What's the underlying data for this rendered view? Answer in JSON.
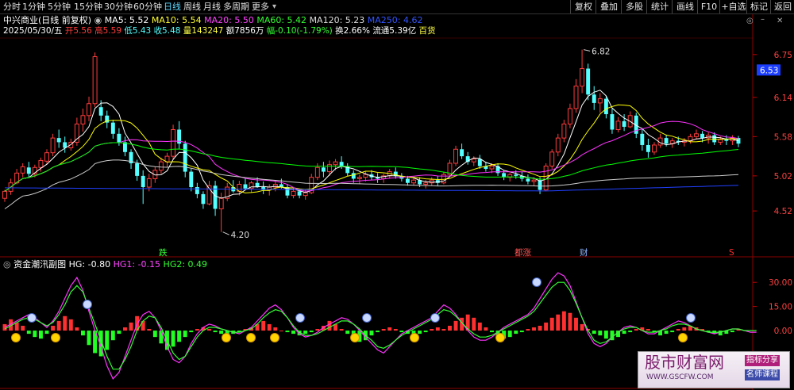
{
  "toolbar": {
    "left_tabs": [
      {
        "label": "分时",
        "x": 4
      },
      {
        "label": "1分钟",
        "x": 28
      },
      {
        "label": "5分钟",
        "x": 60
      },
      {
        "label": "15分钟",
        "x": 93
      },
      {
        "label": "30分钟",
        "x": 131
      },
      {
        "label": "60分钟",
        "x": 168
      },
      {
        "label": "日线",
        "x": 206
      },
      {
        "label": "周线",
        "x": 231
      },
      {
        "label": "月线",
        "x": 256
      },
      {
        "label": "多周期",
        "x": 281
      },
      {
        "label": "更多",
        "x": 317
      }
    ],
    "active_tab": "日线",
    "right_buttons": [
      "复权",
      "叠加",
      "多股",
      "统计",
      "画线",
      "F10",
      "+自选",
      "标记",
      "返回"
    ],
    "icons": [
      "chevron-down-icon",
      "settings-icon",
      "minimize-icon",
      "close-icon"
    ]
  },
  "header": {
    "stock_name": "中兴商业(日线 前复权)",
    "ma5": "MA5: 5.52",
    "ma10": "MA10: 5.54",
    "ma20": "MA20: 5.50",
    "ma60": "MA60: 5.42",
    "ma120": "MA120: 5.23",
    "ma250": "MA250: 4.62",
    "date": "2025/05/30/五",
    "open": "开5.56",
    "high": "高5.59",
    "low": "低5.43",
    "close": "收5.48",
    "volume": "量143247",
    "amount": "额7856万",
    "change": "幅-0.10(-1.79%)",
    "turnover": "换2.66%",
    "float_cap": "流通5.39亿",
    "industry": "百货"
  },
  "price_axis": {
    "ticks": [
      "6.75",
      "6.14",
      "5.58",
      "5.02",
      "4.52"
    ],
    "current": "6.53"
  },
  "price_annotations": {
    "high": "6.82",
    "low": "4.20",
    "markers": [
      "跌",
      "都涨",
      "财",
      "S"
    ]
  },
  "indicator": {
    "title": "资金潮汛副图",
    "hg": "HG: -0.80",
    "hg1": "HG1: -0.15",
    "hg2": "HG2: 0.49",
    "ticks": [
      "30.00",
      "15.00",
      "0.00"
    ]
  },
  "watermark": {
    "brand": "股市财富网",
    "url": "WWW.GSCFW.COM",
    "tag1": "指标分享",
    "tag2": "名师课程"
  },
  "colors": {
    "up": "#ff3c3c",
    "down": "#54ffff",
    "ma5": "#ffffff",
    "ma10": "#ffff00",
    "ma20": "#ff33ff",
    "ma60": "#00ff00",
    "ma120": "#cccccc",
    "ma250": "#2040ff",
    "bg": "#000000"
  },
  "chart_data": {
    "type": "candlestick",
    "ylim": [
      4.2,
      6.9
    ],
    "candles": [
      [
        4.7,
        4.82,
        4.65,
        4.8
      ],
      [
        4.8,
        4.98,
        4.75,
        4.92
      ],
      [
        4.92,
        5.12,
        4.9,
        5.06
      ],
      [
        5.06,
        5.2,
        5.0,
        5.15
      ],
      [
        5.14,
        5.22,
        5.0,
        5.05
      ],
      [
        5.05,
        5.18,
        5.0,
        5.14
      ],
      [
        5.14,
        5.28,
        5.08,
        5.24
      ],
      [
        5.23,
        5.4,
        5.18,
        5.35
      ],
      [
        5.35,
        5.62,
        5.3,
        5.56
      ],
      [
        5.56,
        5.68,
        5.42,
        5.5
      ],
      [
        5.5,
        5.58,
        5.35,
        5.42
      ],
      [
        5.42,
        5.55,
        5.38,
        5.5
      ],
      [
        5.5,
        5.85,
        5.45,
        5.76
      ],
      [
        5.76,
        5.98,
        5.65,
        5.88
      ],
      [
        5.88,
        6.15,
        5.8,
        6.05
      ],
      [
        6.05,
        6.78,
        6.0,
        6.72
      ],
      [
        6.0,
        6.1,
        5.8,
        5.88
      ],
      [
        5.88,
        5.95,
        5.7,
        5.78
      ],
      [
        5.78,
        5.82,
        5.55,
        5.62
      ],
      [
        5.62,
        5.7,
        5.45,
        5.5
      ],
      [
        5.5,
        5.58,
        5.3,
        5.36
      ],
      [
        5.36,
        5.4,
        5.12,
        5.2
      ],
      [
        5.2,
        5.25,
        4.95,
        5.02
      ],
      [
        5.02,
        5.1,
        4.62,
        4.86
      ],
      [
        4.86,
        5.05,
        4.8,
        4.98
      ],
      [
        4.98,
        5.15,
        4.92,
        5.1
      ],
      [
        5.1,
        5.28,
        5.05,
        5.22
      ],
      [
        5.22,
        5.35,
        5.15,
        5.3
      ],
      [
        5.3,
        5.75,
        5.25,
        5.68
      ],
      [
        5.68,
        5.8,
        5.4,
        5.48
      ],
      [
        5.48,
        5.52,
        5.0,
        5.08
      ],
      [
        5.08,
        5.12,
        4.8,
        4.86
      ],
      [
        4.86,
        4.92,
        4.7,
        4.76
      ],
      [
        4.76,
        4.8,
        4.55,
        4.62
      ],
      [
        4.62,
        4.95,
        4.6,
        4.88
      ],
      [
        4.88,
        4.95,
        4.45,
        4.55
      ],
      [
        4.55,
        4.78,
        4.22,
        4.7
      ],
      [
        4.7,
        4.92,
        4.66,
        4.86
      ],
      [
        4.86,
        4.96,
        4.78,
        4.8
      ],
      [
        4.8,
        4.95,
        4.74,
        4.9
      ],
      [
        4.9,
        4.98,
        4.82,
        4.84
      ],
      [
        4.84,
        4.95,
        4.78,
        4.92
      ],
      [
        4.92,
        5.0,
        4.85,
        4.86
      ],
      [
        4.86,
        4.94,
        4.76,
        4.82
      ],
      [
        4.82,
        4.9,
        4.74,
        4.86
      ],
      [
        4.86,
        4.96,
        4.8,
        4.9
      ],
      [
        4.9,
        4.98,
        4.84,
        4.86
      ],
      [
        4.86,
        4.9,
        4.7,
        4.74
      ],
      [
        4.74,
        4.85,
        4.7,
        4.8
      ],
      [
        4.8,
        4.84,
        4.7,
        4.74
      ],
      [
        4.74,
        4.82,
        4.68,
        4.78
      ],
      [
        4.78,
        5.05,
        4.76,
        5.0
      ],
      [
        5.0,
        5.2,
        4.96,
        5.14
      ],
      [
        5.14,
        5.22,
        5.0,
        5.08
      ],
      [
        5.08,
        5.24,
        5.02,
        5.18
      ],
      [
        5.18,
        5.26,
        5.1,
        5.22
      ],
      [
        5.22,
        5.3,
        5.12,
        5.16
      ],
      [
        5.16,
        5.2,
        5.02,
        5.06
      ],
      [
        5.06,
        5.1,
        4.92,
        4.98
      ],
      [
        4.98,
        5.04,
        4.9,
        5.0
      ],
      [
        5.0,
        5.08,
        4.94,
        5.04
      ],
      [
        5.04,
        5.1,
        4.96,
        5.0
      ],
      [
        5.0,
        5.06,
        4.92,
        4.98
      ],
      [
        4.98,
        5.05,
        4.92,
        5.02
      ],
      [
        5.02,
        5.12,
        4.98,
        5.08
      ],
      [
        5.08,
        5.14,
        4.98,
        5.02
      ],
      [
        5.02,
        5.06,
        4.94,
        4.98
      ],
      [
        4.98,
        5.02,
        4.88,
        4.92
      ],
      [
        4.92,
        5.0,
        4.88,
        4.96
      ],
      [
        4.96,
        5.0,
        4.86,
        4.9
      ],
      [
        4.9,
        4.96,
        4.84,
        4.92
      ],
      [
        4.92,
        5.0,
        4.88,
        4.96
      ],
      [
        4.96,
        5.02,
        4.88,
        4.92
      ],
      [
        4.92,
        5.08,
        4.9,
        5.04
      ],
      [
        5.04,
        5.25,
        5.0,
        5.2
      ],
      [
        5.2,
        5.45,
        5.16,
        5.4
      ],
      [
        5.4,
        5.48,
        5.26,
        5.3
      ],
      [
        5.3,
        5.36,
        5.18,
        5.22
      ],
      [
        5.22,
        5.3,
        5.16,
        5.26
      ],
      [
        5.26,
        5.32,
        5.12,
        5.16
      ],
      [
        5.16,
        5.22,
        5.08,
        5.12
      ],
      [
        5.12,
        5.2,
        5.06,
        5.16
      ],
      [
        5.16,
        5.2,
        5.02,
        5.06
      ],
      [
        5.06,
        5.1,
        4.96,
        5.0
      ],
      [
        5.0,
        5.06,
        4.94,
        5.04
      ],
      [
        5.04,
        5.1,
        4.98,
        5.02
      ],
      [
        5.02,
        5.08,
        4.94,
        4.98
      ],
      [
        4.98,
        5.04,
        4.9,
        4.94
      ],
      [
        4.94,
        5.0,
        4.88,
        4.96
      ],
      [
        4.96,
        5.0,
        4.76,
        4.82
      ],
      [
        4.82,
        5.2,
        4.8,
        5.16
      ],
      [
        5.16,
        5.4,
        5.12,
        5.36
      ],
      [
        5.36,
        5.62,
        5.3,
        5.56
      ],
      [
        5.56,
        5.82,
        5.5,
        5.76
      ],
      [
        5.76,
        6.05,
        5.7,
        5.98
      ],
      [
        5.98,
        6.4,
        5.92,
        6.3
      ],
      [
        6.3,
        6.82,
        6.2,
        6.55
      ],
      [
        6.55,
        6.62,
        6.1,
        6.18
      ],
      [
        6.18,
        6.3,
        5.96,
        6.06
      ],
      [
        6.06,
        6.2,
        5.92,
        6.12
      ],
      [
        6.12,
        6.16,
        5.84,
        5.9
      ],
      [
        5.9,
        5.98,
        5.62,
        5.68
      ],
      [
        5.68,
        5.86,
        5.64,
        5.8
      ],
      [
        5.8,
        5.9,
        5.66,
        5.72
      ],
      [
        5.72,
        5.94,
        5.7,
        5.88
      ],
      [
        5.88,
        5.92,
        5.56,
        5.62
      ],
      [
        5.62,
        5.7,
        5.38,
        5.46
      ],
      [
        5.46,
        5.55,
        5.28,
        5.36
      ],
      [
        5.36,
        5.5,
        5.32,
        5.46
      ],
      [
        5.46,
        5.62,
        5.42,
        5.56
      ],
      [
        5.56,
        5.6,
        5.44,
        5.48
      ],
      [
        5.48,
        5.56,
        5.42,
        5.52
      ],
      [
        5.52,
        5.58,
        5.46,
        5.5
      ],
      [
        5.5,
        5.56,
        5.44,
        5.52
      ],
      [
        5.52,
        5.62,
        5.48,
        5.58
      ],
      [
        5.58,
        5.68,
        5.54,
        5.62
      ],
      [
        5.62,
        5.66,
        5.5,
        5.56
      ],
      [
        5.56,
        5.64,
        5.48,
        5.6
      ],
      [
        5.6,
        5.64,
        5.46,
        5.5
      ],
      [
        5.5,
        5.58,
        5.46,
        5.54
      ],
      [
        5.54,
        5.6,
        5.46,
        5.52
      ],
      [
        5.52,
        5.6,
        5.46,
        5.56
      ],
      [
        5.56,
        5.59,
        5.43,
        5.48
      ]
    ],
    "indicator_bars": [
      4,
      7,
      5,
      3,
      -2,
      -4,
      -5,
      -2,
      3,
      6,
      9,
      7,
      2,
      -3,
      -9,
      -14,
      -16,
      -12,
      -6,
      -2,
      2,
      5,
      9,
      6,
      1,
      -4,
      -8,
      -12,
      -10,
      -7,
      -4,
      -1,
      1,
      2,
      1,
      -1,
      -2,
      -3,
      -2,
      -1,
      1,
      2,
      4,
      6,
      4,
      2,
      0,
      -1,
      -2,
      -3,
      -2,
      -1,
      1,
      3,
      6,
      4,
      1,
      -2,
      -5,
      -7,
      -6,
      -3,
      -1,
      1,
      2,
      1,
      -1,
      -2,
      -3,
      -2,
      -1,
      1,
      2,
      1,
      3,
      6,
      8,
      10,
      8,
      5,
      2,
      -1,
      -3,
      -5,
      -4,
      -2,
      -1,
      1,
      2,
      3,
      5,
      8,
      10,
      12,
      11,
      8,
      4,
      1,
      -2,
      -3,
      -5,
      -6,
      -4,
      -2,
      -1,
      1,
      2,
      1,
      -1,
      -3,
      -2,
      -1,
      1,
      2,
      3,
      2,
      1,
      -1,
      -2,
      -3,
      -2,
      -1,
      1
    ],
    "hg1_line": [
      2,
      4,
      6,
      8,
      10,
      8,
      5,
      2,
      6,
      12,
      20,
      28,
      33,
      25,
      12,
      0,
      -10,
      -22,
      -30,
      -26,
      -16,
      -6,
      4,
      10,
      12,
      8,
      0,
      -10,
      -18,
      -20,
      -16,
      -8,
      -2,
      2,
      4,
      3,
      1,
      0,
      -1,
      -2,
      0,
      2,
      6,
      10,
      14,
      16,
      13,
      8,
      2,
      -2,
      -4,
      -3,
      -1,
      2,
      4,
      6,
      8,
      7,
      4,
      0,
      -4,
      -8,
      -12,
      -14,
      -10,
      -6,
      -2,
      0,
      2,
      4,
      6,
      8,
      12,
      16,
      14,
      10,
      5,
      0,
      -4,
      -6,
      -6,
      -4,
      -1,
      2,
      4,
      6,
      8,
      10,
      14,
      20,
      26,
      32,
      36,
      34,
      28,
      18,
      8,
      -2,
      -8,
      -10,
      -8,
      -4,
      -1,
      2,
      3,
      2,
      0,
      -2,
      -2,
      0,
      2,
      4,
      6,
      5,
      3,
      1,
      0,
      -1,
      -2,
      -1,
      0,
      1,
      1,
      0,
      -1,
      -1
    ],
    "hg2_line": [
      1,
      3,
      5,
      7,
      8,
      7,
      5,
      3,
      5,
      10,
      16,
      24,
      28,
      24,
      14,
      4,
      -6,
      -16,
      -24,
      -24,
      -18,
      -10,
      0,
      6,
      9,
      8,
      2,
      -6,
      -14,
      -18,
      -16,
      -10,
      -4,
      0,
      2,
      2,
      1,
      0,
      -1,
      -1,
      0,
      1,
      4,
      8,
      11,
      13,
      12,
      8,
      3,
      -1,
      -3,
      -3,
      -2,
      0,
      2,
      4,
      6,
      6,
      4,
      1,
      -3,
      -6,
      -10,
      -11,
      -9,
      -6,
      -3,
      -1,
      1,
      3,
      5,
      7,
      10,
      13,
      12,
      9,
      5,
      1,
      -2,
      -4,
      -4,
      -3,
      -1,
      1,
      3,
      5,
      7,
      9,
      12,
      17,
      22,
      27,
      30,
      30,
      25,
      17,
      8,
      0,
      -6,
      -8,
      -7,
      -4,
      -1,
      1,
      2,
      2,
      0,
      -1,
      -1,
      0,
      1,
      3,
      4,
      4,
      3,
      1,
      0,
      -1,
      -1,
      -1,
      0,
      1,
      1,
      0,
      0,
      0
    ]
  }
}
